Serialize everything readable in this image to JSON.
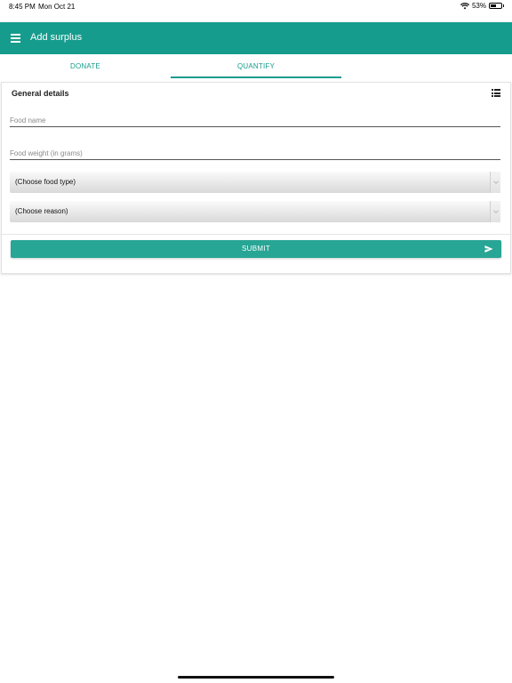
{
  "status_bar": {
    "time": "8:45 PM",
    "date": "Mon Oct 21",
    "battery_percent": "53%",
    "battery_level": 0.53,
    "icons": [
      "wifi-icon",
      "battery-icon"
    ]
  },
  "app_bar": {
    "title": "Add surplus",
    "color": "#169c8d",
    "menu_icon": "menu-icon"
  },
  "tabs": [
    {
      "label": "DONATE",
      "selected": false
    },
    {
      "label": "QUANTIFY",
      "selected": true
    }
  ],
  "card": {
    "header": "General details",
    "header_icon": "list-icon",
    "fields": {
      "food_name": {
        "placeholder": "Food name",
        "value": ""
      },
      "food_weight": {
        "placeholder": "Food weight (in grams)",
        "value": ""
      }
    },
    "selects": {
      "food_type": {
        "selected": "(Choose food type)"
      },
      "reason": {
        "selected": "(Choose reason)"
      }
    },
    "submit": {
      "label": "SUBMIT",
      "icon": "send-icon",
      "color": "#27a595"
    }
  }
}
